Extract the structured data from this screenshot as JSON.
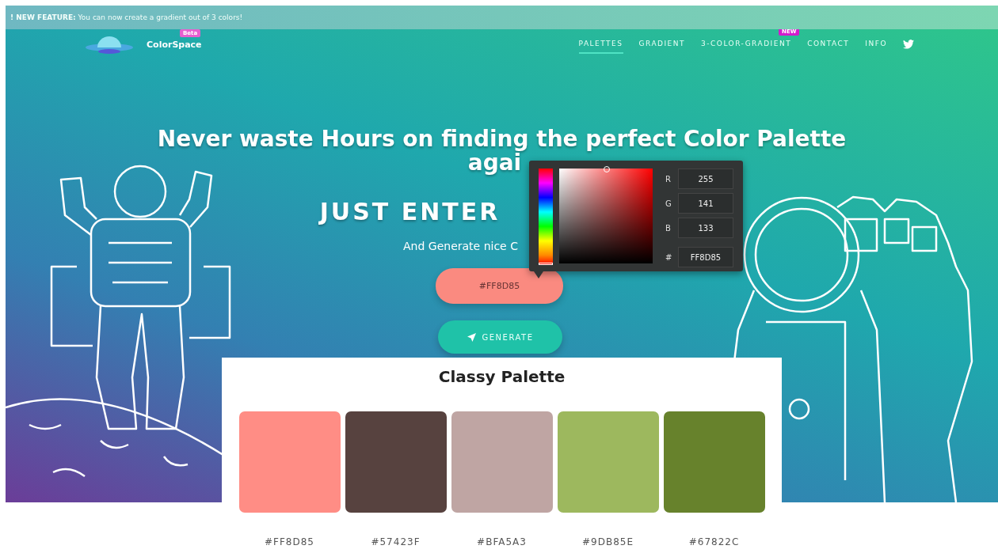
{
  "banner": {
    "text": "**! NEW FEATURE:** You can now create a gradient out of 3 colors!"
  },
  "brand": {
    "name": "ColorSpace",
    "badge": "Beta"
  },
  "nav": [
    {
      "label": "PALETTES",
      "selected": true
    },
    {
      "label": "GRADIENT",
      "selected": false
    },
    {
      "label": "3-COLOR-GRADIENT",
      "selected": false,
      "badge": "NEW"
    },
    {
      "label": "CONTACT",
      "selected": false
    },
    {
      "label": "INFO",
      "selected": false
    }
  ],
  "hero": {
    "title_lines": [
      "Never waste Hours on finding the perfect Color Palette",
      "agai"
    ],
    "tagline": "JUST ENTER",
    "subtitle": "And Generate nice C"
  },
  "color_input": {
    "value": "#FF8D85"
  },
  "picker": {
    "hue": {
      "level": 0
    },
    "fields": [
      {
        "label": "R",
        "value": "255"
      },
      {
        "label": "G",
        "value": "141"
      },
      {
        "label": "B",
        "value": "133"
      },
      {
        "label": "#",
        "value": "FF8D85"
      }
    ]
  },
  "generate_button": "GENERATE",
  "palette": {
    "title": "Classy Palette",
    "swatches": [
      {
        "color": "#ff8d85",
        "hex": "#FF8D85"
      },
      {
        "color": "#57423f",
        "hex": "#57423F"
      },
      {
        "color": "#bfa5a3",
        "hex": "#BFA5A3"
      },
      {
        "color": "#9db85e",
        "hex": "#9DB85E"
      },
      {
        "color": "#67822c",
        "hex": "#67822C"
      }
    ]
  }
}
